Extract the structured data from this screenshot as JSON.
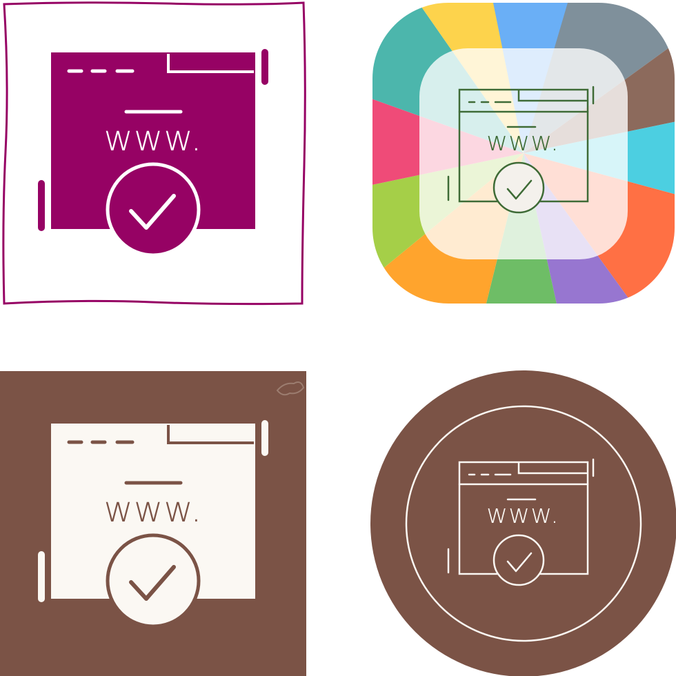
{
  "icon_set": {
    "subject": "web domain verified",
    "glyph_text": "www.",
    "variants": [
      {
        "style": "glyph-on-framed-square",
        "icon": "browser-www-check-icon",
        "color": "#960264",
        "background": "#ffffff"
      },
      {
        "style": "line-on-rainbow-rounded-square",
        "icon": "browser-www-check-icon",
        "color": "#3e6b36",
        "background": "rainbow"
      },
      {
        "style": "glyph-on-solid-square",
        "icon": "browser-www-check-icon",
        "color": "#fbf8f3",
        "background": "#7b5346"
      },
      {
        "style": "line-on-solid-circle",
        "icon": "browser-www-check-icon",
        "color": "#fbf8f3",
        "background": "#7b5346"
      }
    ]
  },
  "colors": {
    "magenta": "#960264",
    "brown": "#7b5346",
    "cream": "#fbf8f3",
    "green_line": "#3e6b36",
    "rainbow": [
      "#fdd34c",
      "#6aaff6",
      "#7f909b",
      "#8c6a5c",
      "#4ccfe1",
      "#ff7044",
      "#9776d0",
      "#6ebd66",
      "#ffa42d",
      "#a5cf48",
      "#ef4b78",
      "#4cb6ac"
    ]
  }
}
